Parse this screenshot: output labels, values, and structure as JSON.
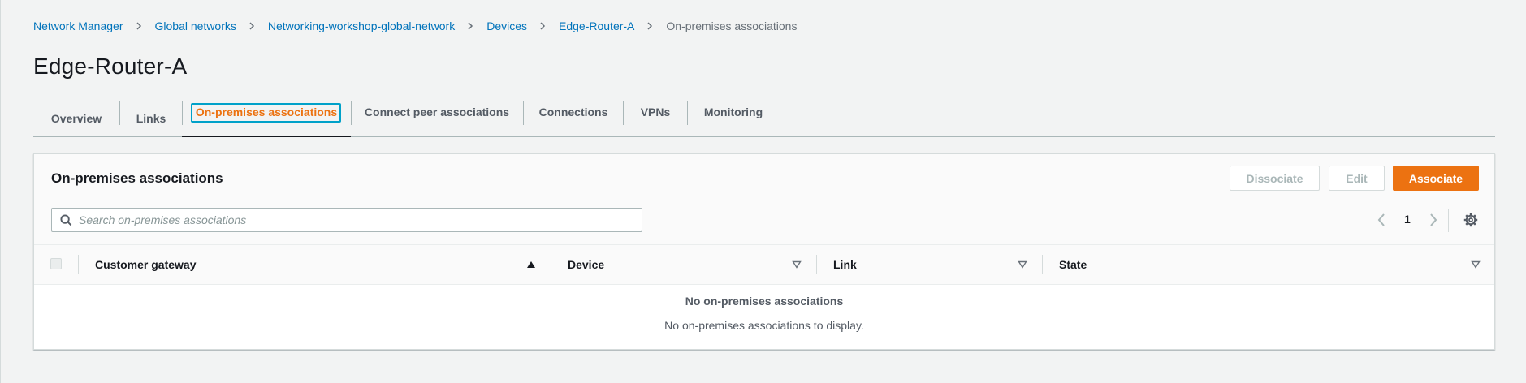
{
  "breadcrumb": {
    "items": [
      {
        "label": "Network Manager"
      },
      {
        "label": "Global networks"
      },
      {
        "label": "Networking-workshop-global-network"
      },
      {
        "label": "Devices"
      },
      {
        "label": "Edge-Router-A"
      }
    ],
    "current": "On-premises associations"
  },
  "page": {
    "title": "Edge-Router-A"
  },
  "tabs": [
    {
      "label": "Overview"
    },
    {
      "label": "Links"
    },
    {
      "label": "On-premises associations",
      "active": true
    },
    {
      "label": "Connect peer associations"
    },
    {
      "label": "Connections"
    },
    {
      "label": "VPNs"
    },
    {
      "label": "Monitoring"
    }
  ],
  "panel": {
    "title": "On-premises associations",
    "buttons": {
      "dissociate": "Dissociate",
      "edit": "Edit",
      "associate": "Associate"
    },
    "search": {
      "placeholder": "Search on-premises associations",
      "value": ""
    },
    "pagination": {
      "current_page": "1"
    },
    "table": {
      "columns": [
        {
          "label": "Customer gateway",
          "sort": "ascending"
        },
        {
          "label": "Device",
          "sort": "none"
        },
        {
          "label": "Link",
          "sort": "none"
        },
        {
          "label": "State",
          "sort": "none"
        }
      ],
      "empty_title": "No on-premises associations",
      "empty_description": "No on-premises associations to display."
    }
  },
  "colors": {
    "accent": "#ec7211",
    "link": "#0073bb",
    "focus_outline": "#00a1c9",
    "background": "#f2f3f3"
  },
  "icons": [
    "chevron-right-icon",
    "search-icon",
    "chevron-left-icon",
    "settings-gear-icon",
    "sort-ascending-icon",
    "sort-descending-outline-icon"
  ]
}
